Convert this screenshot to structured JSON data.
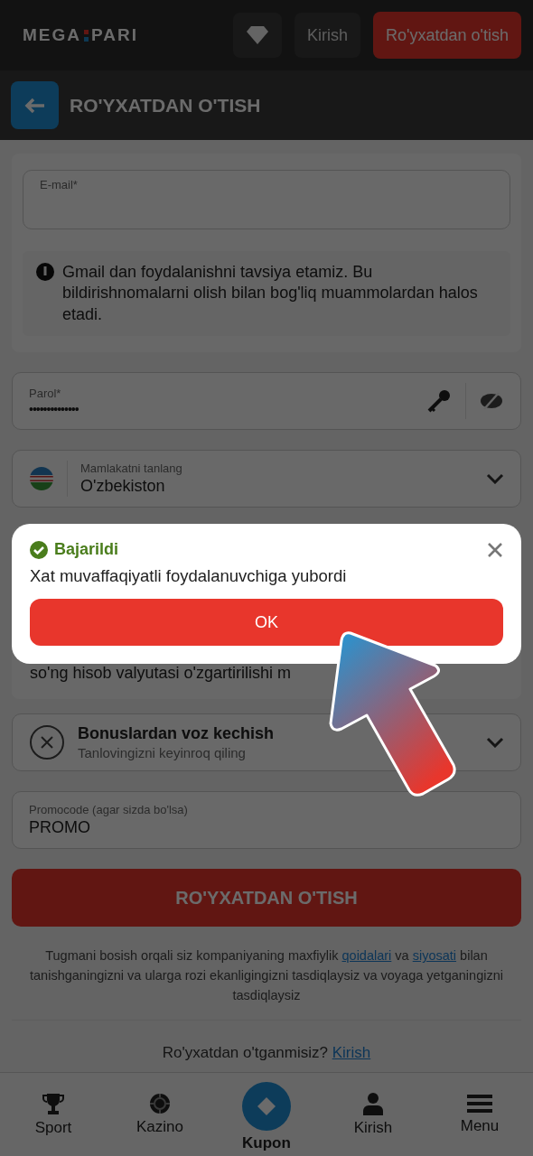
{
  "header": {
    "logo": {
      "left": "MEGA",
      "right": "PARI"
    },
    "login_button": "Kirish",
    "register_button": "Ro'yxatdan o'tish"
  },
  "page_title": "RO'YXATDAN O'TISH",
  "form": {
    "email": {
      "label": "E-mail*"
    },
    "email_hint": "Gmail dan foydalanishni tavsiya etamiz. Bu bildirishnomalarni olish bilan bog'liq muammolardan halos etadi.",
    "password": {
      "label": "Parol*",
      "value": "••••••••••••••"
    },
    "country": {
      "label": "Mamlakatni tanlang",
      "value": "O'zbekiston"
    },
    "currency_note": "so'ng hisob valyutasi o'zgartirilishi m",
    "bonus": {
      "title": "Bonuslardan voz kechish",
      "subtitle": "Tanlovingizni keyinroq qiling"
    },
    "promo": {
      "label": "Promocode (agar sizda bo'lsa)",
      "value": "PROMO"
    },
    "submit": "RO'YXATDAN O'TISH",
    "terms": [
      {
        "kind": "text",
        "text": "Tugmani bosish orqali siz kompaniyaning maxfiylik "
      },
      {
        "kind": "link",
        "text": "qoidalari"
      },
      {
        "kind": "text",
        "text": " va "
      },
      {
        "kind": "link",
        "text": "siyosati"
      },
      {
        "kind": "text",
        "text": " bilan tanishganingizni va ularga rozi ekanligingizni tasdiqlaysiz va voyaga yetganingizni tasdiqlaysiz"
      }
    ],
    "login_prompt": {
      "text": "Ro'yxatdan o'tganmisiz?",
      "link": "Kirish"
    }
  },
  "bottom_nav": [
    {
      "label": "Sport",
      "selected": false
    },
    {
      "label": "Kazino",
      "selected": false
    },
    {
      "label": "Kupon",
      "selected": true
    },
    {
      "label": "Kirish",
      "selected": false
    },
    {
      "label": "Menu",
      "selected": false
    }
  ],
  "dialog": {
    "title": "Bajarildi",
    "message": "Xat muvaffaqiyatli foydalanuvchiga yubordi",
    "button": "OK"
  }
}
